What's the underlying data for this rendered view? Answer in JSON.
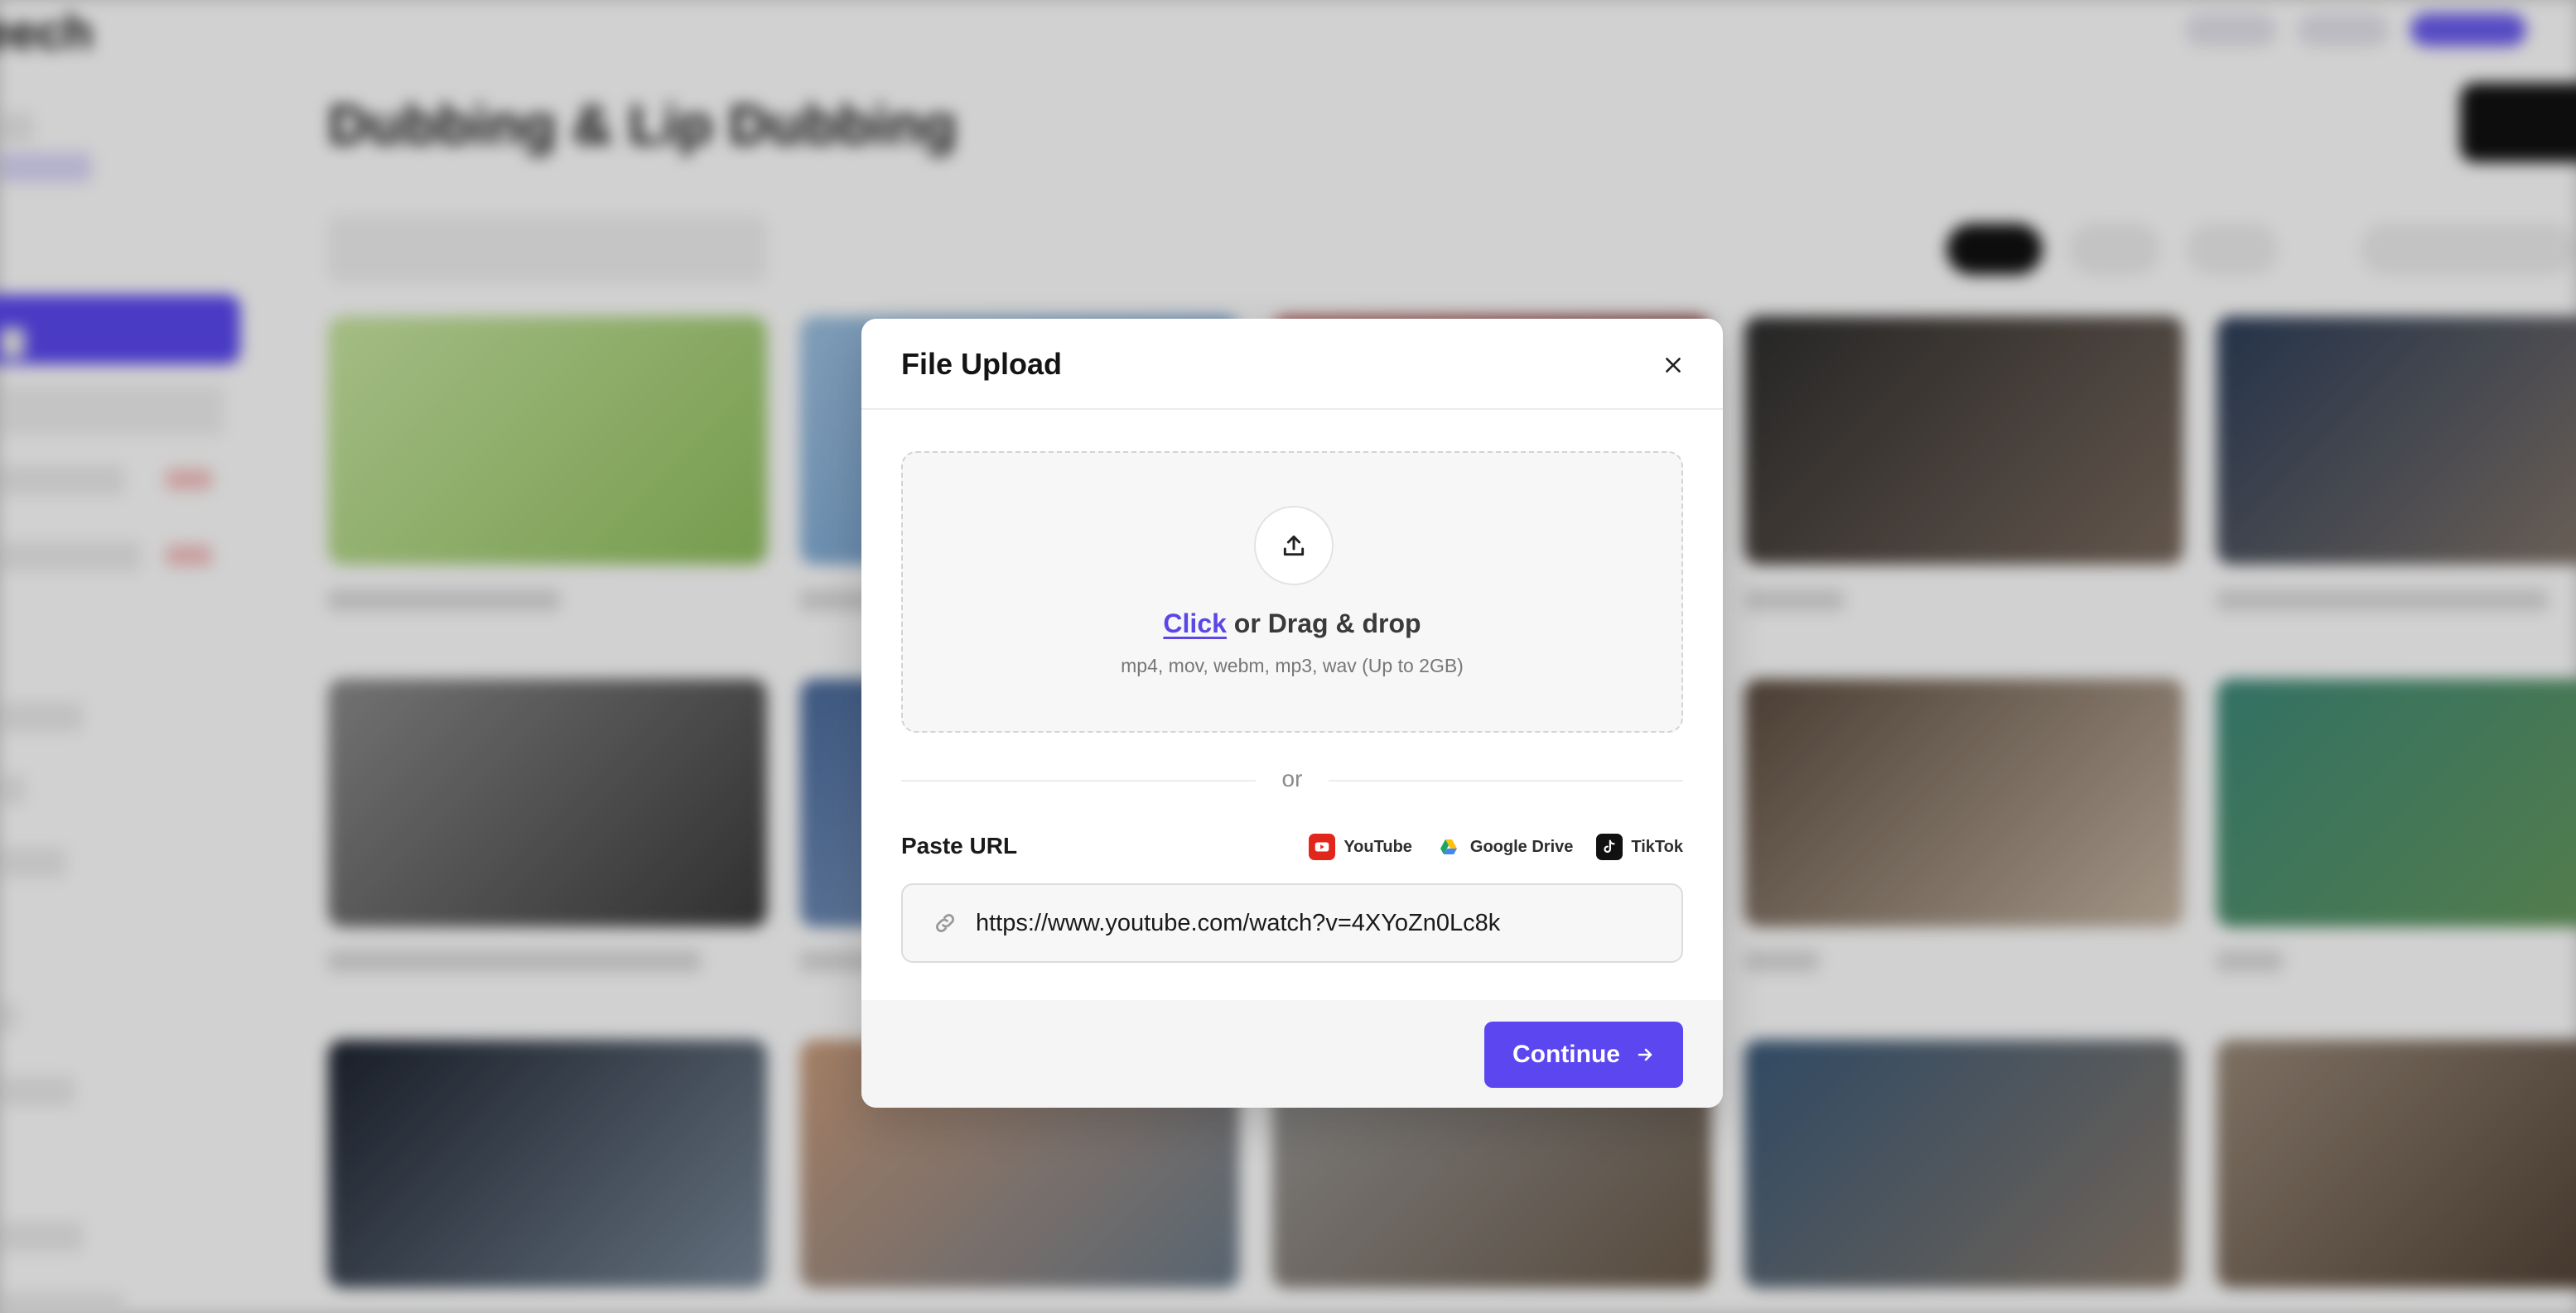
{
  "background": {
    "page_title": "Dubbing & Lip Dubbing"
  },
  "modal": {
    "title": "File Upload",
    "dropzone": {
      "click_label": "Click",
      "rest_label": " or Drag & drop",
      "formats": "mp4, mov, webm, mp3, wav (Up to 2GB)"
    },
    "divider_text": "or",
    "paste_label": "Paste URL",
    "sources": [
      {
        "name": "YouTube",
        "icon": "youtube-icon",
        "color": "#e3261c"
      },
      {
        "name": "Google Drive",
        "icon": "google-drive-icon",
        "color": "#1fa463"
      },
      {
        "name": "TikTok",
        "icon": "tiktok-icon",
        "color": "#111111"
      }
    ],
    "url_input": {
      "value": "https://www.youtube.com/watch?v=4XYoZn0Lc8k",
      "icon": "link-icon"
    },
    "continue_label": "Continue"
  },
  "colors": {
    "accent": "#5b46f0",
    "overlay": "#d0d0d0"
  }
}
